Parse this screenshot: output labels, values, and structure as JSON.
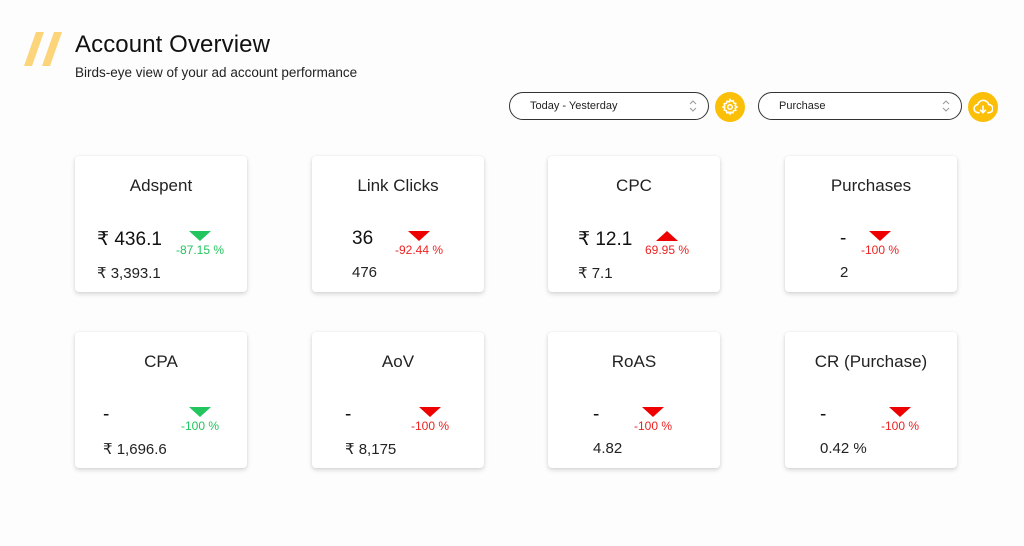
{
  "header": {
    "logo_icon": "double-slash-logo",
    "title": "Account Overview",
    "subtitle": "Birds-eye view of your ad account performance"
  },
  "controls": {
    "date_range": {
      "selected": "Today - Yesterday",
      "icon": "chevron-up-down-icon"
    },
    "settings_button": {
      "icon": "gear-icon",
      "color": "#fcbf07"
    },
    "event": {
      "selected": "Purchase",
      "icon": "chevron-up-down-icon"
    },
    "download_button": {
      "icon": "cloud-download-icon",
      "color": "#fcbf07"
    }
  },
  "colors": {
    "accent": "#fcbf07",
    "positive": "#22c55e",
    "negative": "#ee0000"
  },
  "cards": [
    {
      "label": "Adspent",
      "value": "₹ 436.1",
      "change": "-87.15 %",
      "direction": "down",
      "sentiment": "good",
      "previous": "₹ 3,393.1"
    },
    {
      "label": "Link Clicks",
      "value": "36",
      "change": "-92.44 %",
      "direction": "down",
      "sentiment": "bad",
      "previous": "476"
    },
    {
      "label": "CPC",
      "value": "₹ 12.1",
      "change": "69.95 %",
      "direction": "up",
      "sentiment": "bad",
      "previous": "₹ 7.1"
    },
    {
      "label": "Purchases",
      "value": "-",
      "change": "-100 %",
      "direction": "down",
      "sentiment": "bad",
      "previous": "2"
    },
    {
      "label": "CPA",
      "value": "-",
      "change": "-100 %",
      "direction": "down",
      "sentiment": "good",
      "previous": "₹ 1,696.6"
    },
    {
      "label": "AoV",
      "value": "-",
      "change": "-100 %",
      "direction": "down",
      "sentiment": "bad",
      "previous": "₹ 8,175"
    },
    {
      "label": "RoAS",
      "value": "-",
      "change": "-100 %",
      "direction": "down",
      "sentiment": "bad",
      "previous": "4.82"
    },
    {
      "label": "CR (Purchase)",
      "value": "-",
      "change": "-100 %",
      "direction": "down",
      "sentiment": "bad",
      "previous": "0.42 %"
    }
  ]
}
